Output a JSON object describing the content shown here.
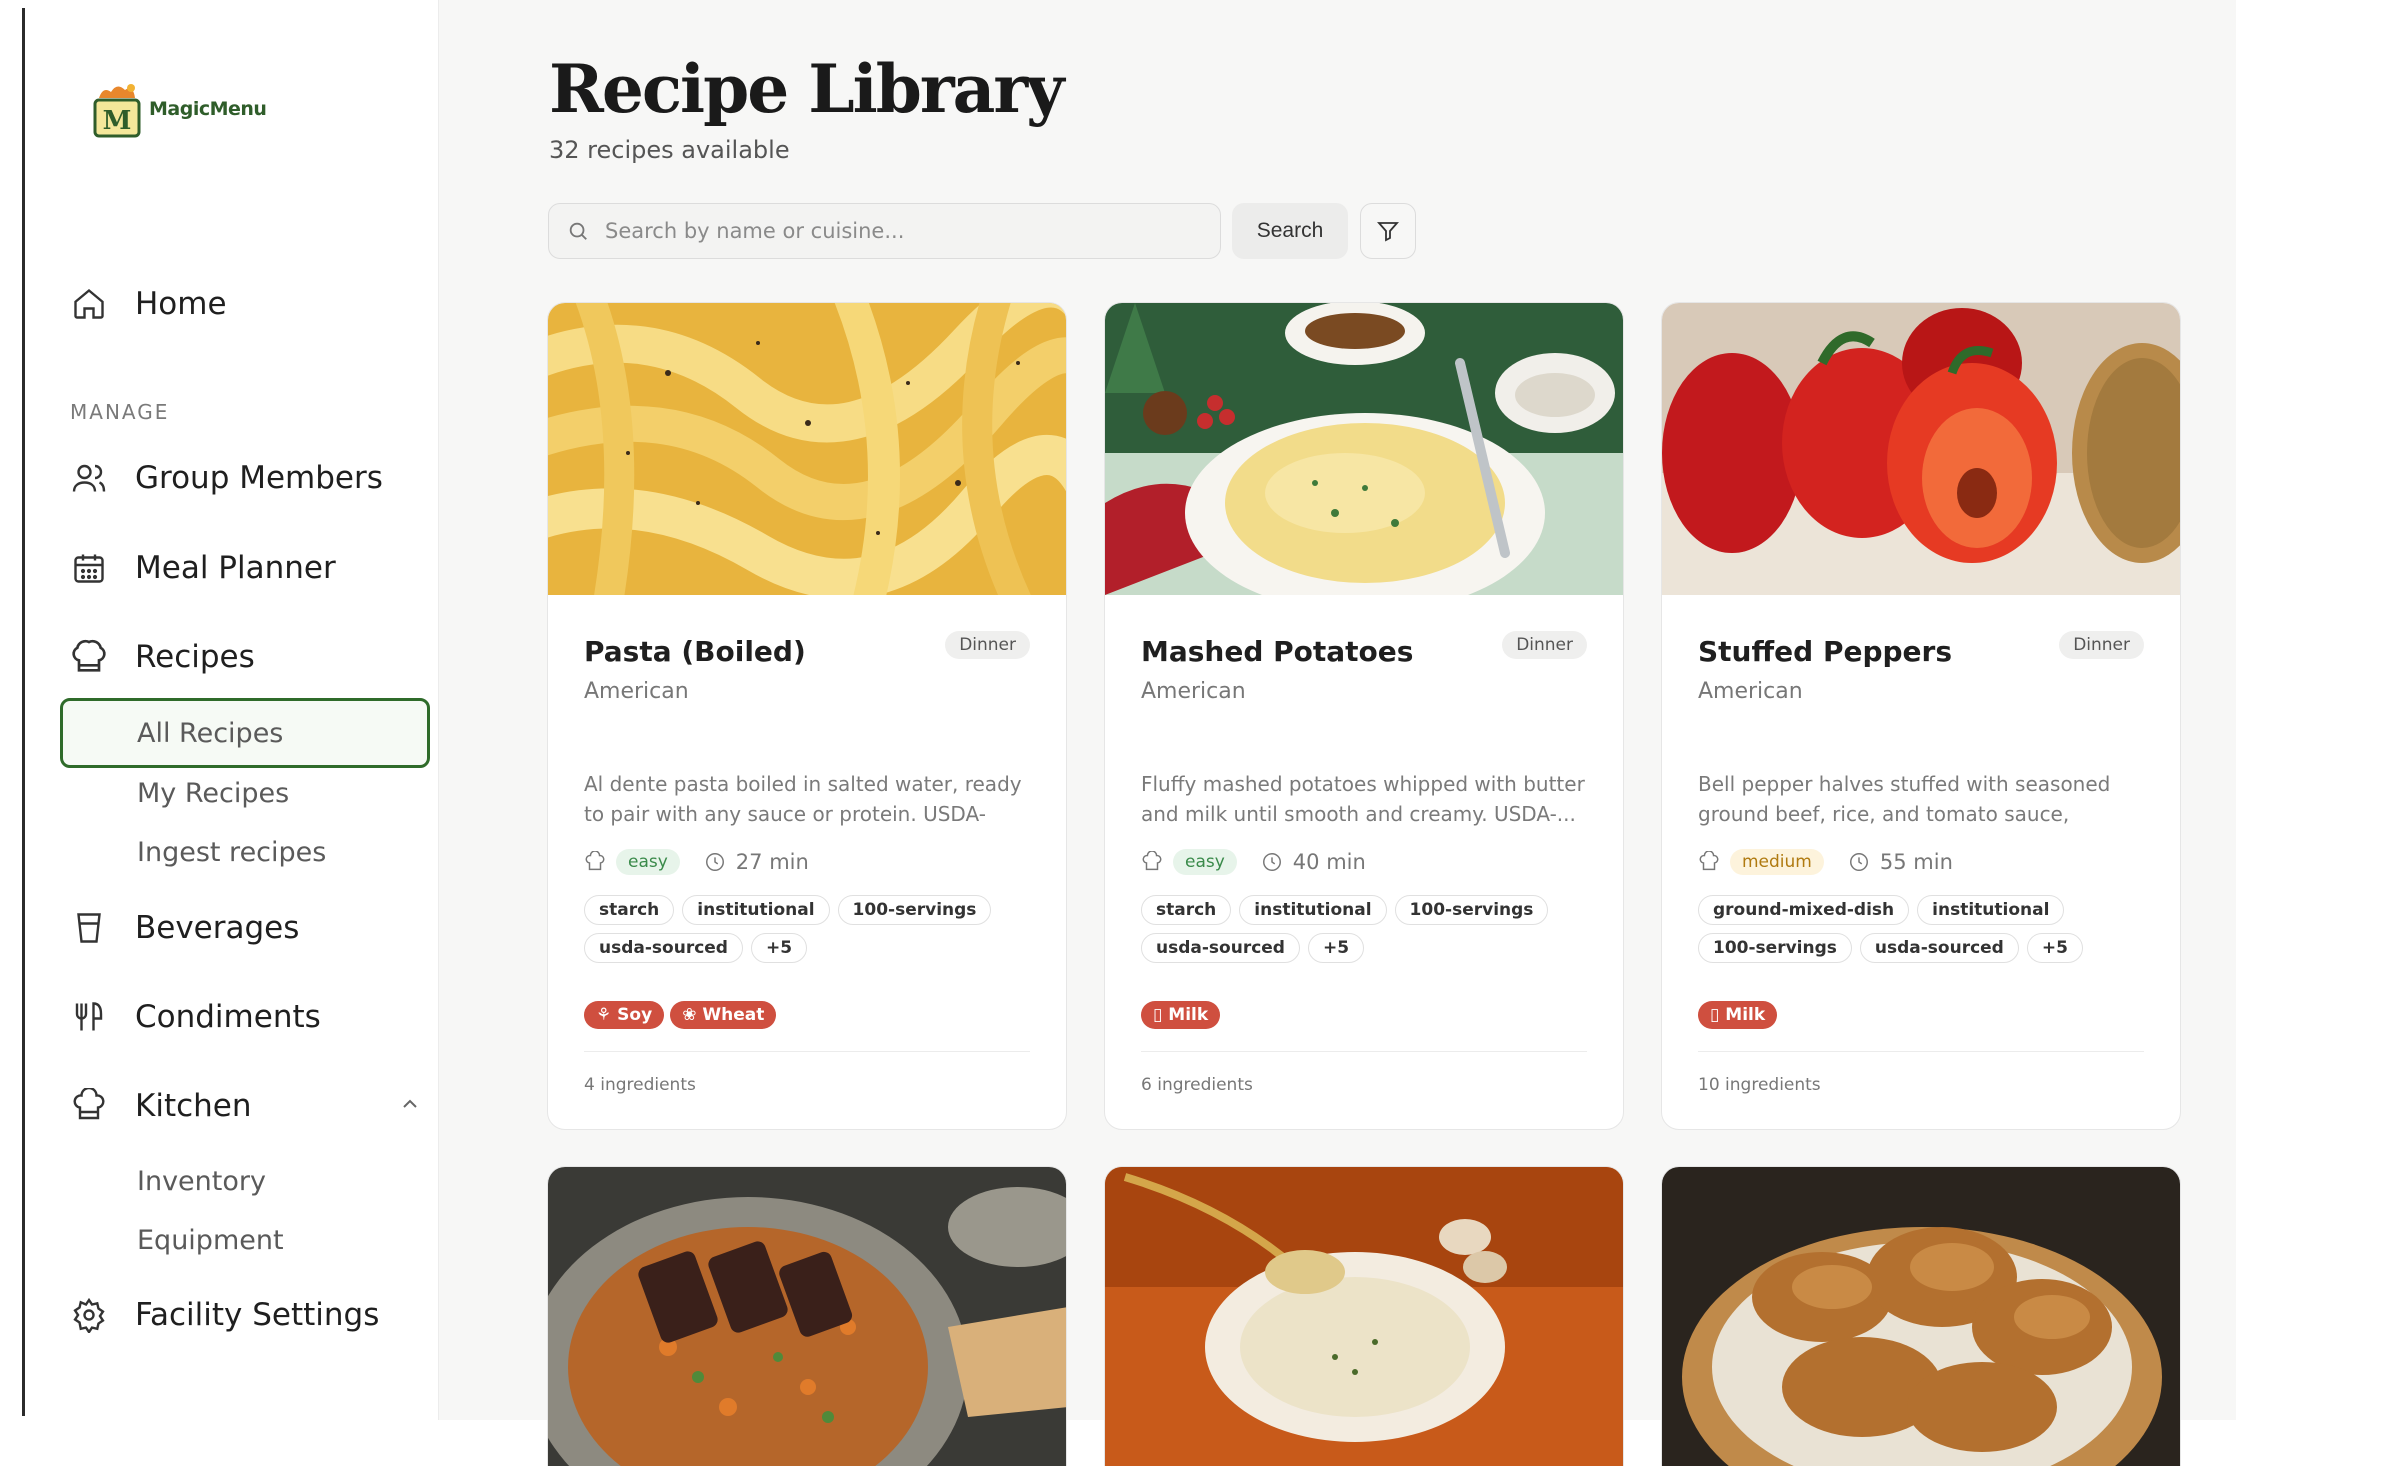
{
  "app": {
    "logo_text": "MagicMenu",
    "logo_letter": "M"
  },
  "sidebar": {
    "home": "Home",
    "section": "MANAGE",
    "group_members": "Group Members",
    "meal_planner": "Meal Planner",
    "recipes": "Recipes",
    "recipes_sub": [
      "All Recipes",
      "My Recipes",
      "Ingest recipes"
    ],
    "beverages": "Beverages",
    "condiments": "Condiments",
    "kitchen": "Kitchen",
    "kitchen_sub": [
      "Inventory",
      "Equipment"
    ],
    "facility_settings": "Facility Settings"
  },
  "main": {
    "title": "Recipe Library",
    "subtitle": "32 recipes available",
    "search_placeholder": "Search by name or cuisine...",
    "search_button": "Search"
  },
  "recipes": [
    {
      "title": "Pasta (Boiled)",
      "meal": "Dinner",
      "cuisine": "American",
      "description": "Al dente pasta boiled in salted water, ready to pair with any sauce or protein. USDA-sourced...",
      "difficulty": "easy",
      "time": "27 min",
      "tags": [
        "starch",
        "institutional",
        "100-servings",
        "usda-sourced",
        "+5"
      ],
      "allergens": [
        "Soy",
        "Wheat"
      ],
      "ingredients": "4 ingredients"
    },
    {
      "title": "Mashed Potatoes",
      "meal": "Dinner",
      "cuisine": "American",
      "description": "Fluffy mashed potatoes whipped with butter and milk until smooth and creamy. USDA-...",
      "difficulty": "easy",
      "time": "40 min",
      "tags": [
        "starch",
        "institutional",
        "100-servings",
        "usda-sourced",
        "+5"
      ],
      "allergens": [
        "Milk"
      ],
      "ingredients": "6 ingredients"
    },
    {
      "title": "Stuffed Peppers",
      "meal": "Dinner",
      "cuisine": "American",
      "description": "Bell pepper halves stuffed with seasoned ground beef, rice, and tomato sauce, baked...",
      "difficulty": "medium",
      "time": "55 min",
      "tags": [
        "ground-mixed-dish",
        "institutional",
        "100-servings",
        "usda-sourced",
        "+5"
      ],
      "allergens": [
        "Milk"
      ],
      "ingredients": "10 ingredients"
    }
  ],
  "colors": {
    "accent_green": "#2f6b2a",
    "allergen_red": "#cf4f3f",
    "easy_green": "#3a8a4a",
    "medium_amber": "#b07a10"
  }
}
